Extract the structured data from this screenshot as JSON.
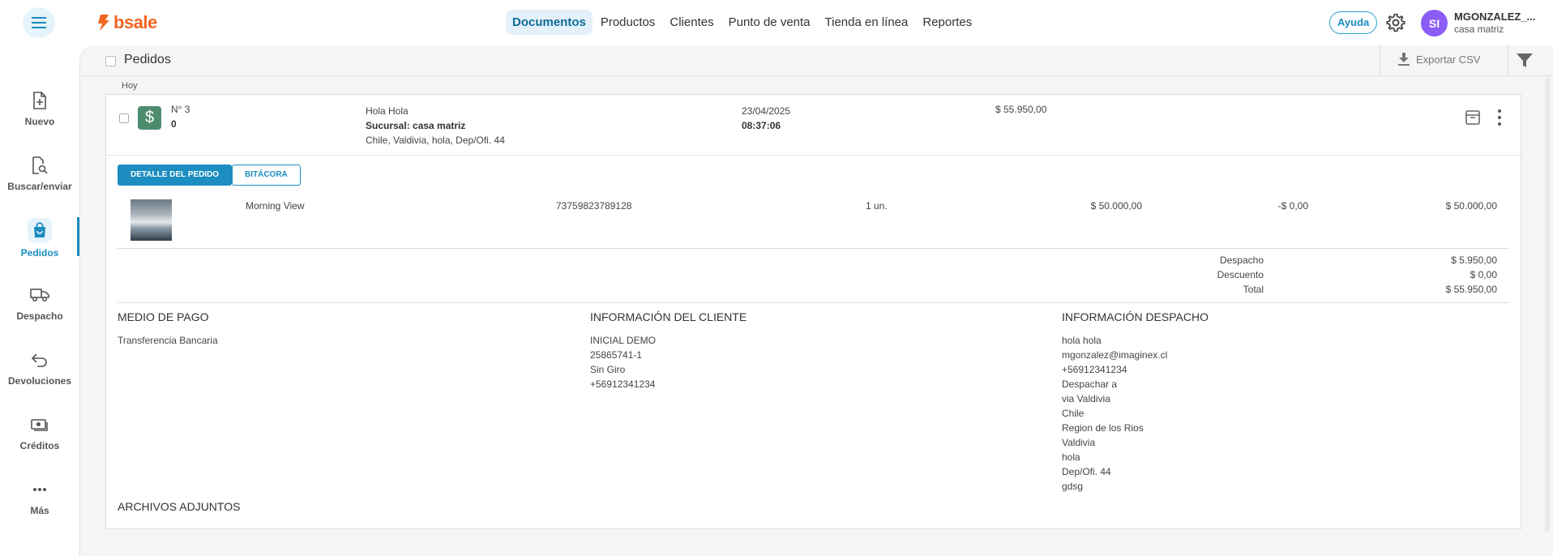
{
  "brand": {
    "logo_text": "bsale",
    "accent": "#1b8dc0",
    "logo_color": "#f26522"
  },
  "nav": {
    "items": [
      {
        "label": "Documentos",
        "active": true
      },
      {
        "label": "Productos"
      },
      {
        "label": "Clientes"
      },
      {
        "label": "Punto de venta"
      },
      {
        "label": "Tienda en línea"
      },
      {
        "label": "Reportes"
      }
    ]
  },
  "header": {
    "help_label": "Ayuda",
    "avatar_initials": "SI",
    "user_name": "MGONZALEZ_...",
    "user_branch": "casa matriz"
  },
  "sidebar": {
    "items": [
      {
        "label": "Nuevo",
        "icon": "new-document-icon"
      },
      {
        "label": "Buscar/enviar",
        "icon": "search-document-icon"
      },
      {
        "label": "Pedidos",
        "icon": "shopping-bag-icon",
        "active": true
      },
      {
        "label": "Despacho",
        "icon": "truck-icon"
      },
      {
        "label": "Devoluciones",
        "icon": "return-arrow-icon"
      },
      {
        "label": "Créditos",
        "icon": "money-icon"
      },
      {
        "label": "Más",
        "icon": "more-dots-icon"
      }
    ]
  },
  "list": {
    "title": "Pedidos",
    "export_label": "Exportar CSV",
    "group_label": "Hoy"
  },
  "order": {
    "number": "N° 3",
    "sub_number": "0",
    "client_name": "Hola Hola",
    "branch": "Sucursal: casa matriz",
    "address": "Chile, Valdivia, hola, Dep/Ofi. 44",
    "date": "23/04/2025",
    "time": "08:37:06",
    "amount": "$ 55.950,00",
    "tabs": {
      "detail": "DETALLE DEL PEDIDO",
      "log": "BITÁCORA"
    },
    "line_item": {
      "name": "Morning View",
      "code": "73759823789128",
      "quantity": "1 un.",
      "price": "$ 50.000,00",
      "discount": "-$ 0,00",
      "total": "$ 50.000,00"
    },
    "totals": [
      {
        "label": "Despacho",
        "value": "$ 5.950,00"
      },
      {
        "label": "Descuento",
        "value": "$ 0,00"
      },
      {
        "label": "Total",
        "value": "$ 55.950,00"
      }
    ],
    "payment": {
      "title": "MEDIO DE PAGO",
      "lines": [
        "Transferencia Bancaria"
      ]
    },
    "customer": {
      "title": "INFORMACIÓN DEL CLIENTE",
      "lines": [
        "INICIAL DEMO",
        "25865741-1",
        "Sin Giro",
        "+56912341234"
      ]
    },
    "shipping": {
      "title": "INFORMACIÓN DESPACHO",
      "lines": [
        "hola hola",
        "mgonzalez@imaginex.cl",
        "+56912341234",
        "Despachar a",
        "via Valdivia",
        "Chile",
        "Region de los Rios",
        "Valdivia",
        "hola",
        "Dep/Ofi. 44",
        "gdsg"
      ]
    },
    "attachments_title": "ARCHIVOS ADJUNTOS"
  }
}
